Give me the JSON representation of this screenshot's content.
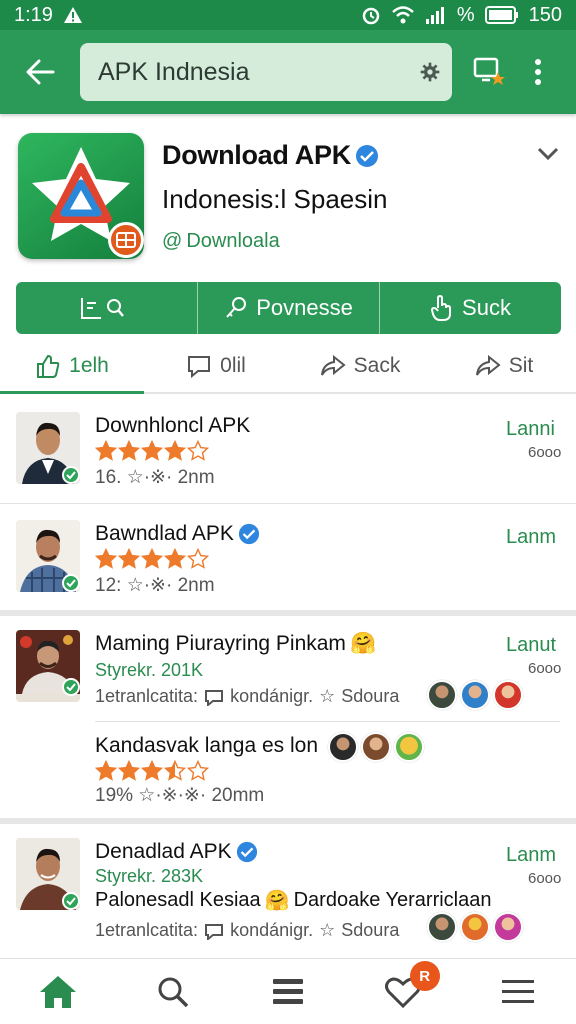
{
  "status": {
    "time": "1:19",
    "battery": "150"
  },
  "search": {
    "value": "APK Indnesia"
  },
  "app": {
    "title": "Download APK",
    "subtitle": "Indonesis:l Spaesin",
    "developer": "Downloala"
  },
  "actions": [
    {
      "label": "",
      "icon": "chart-search-icon"
    },
    {
      "label": "Povnesse",
      "icon": "key-icon"
    },
    {
      "label": "Suck",
      "icon": "hand-pointer-icon"
    }
  ],
  "tabs": [
    {
      "label": "1elh",
      "icon": "thumb-icon",
      "active": true
    },
    {
      "label": "0lil",
      "icon": "comment-icon"
    },
    {
      "label": "Sack",
      "icon": "share-icon"
    },
    {
      "label": "Sit",
      "icon": "forward-icon"
    }
  ],
  "items": [
    {
      "name": "Downhloncl APK",
      "rating": 4,
      "meta": "16. ☆·※· 2nm",
      "right_label": "Lanni",
      "right_count": "6ooo"
    },
    {
      "name": "Bawndlad APK",
      "rating": 4,
      "verified": true,
      "meta": "12: ☆·※· 2nm",
      "right_label": "Lanm"
    },
    {
      "name": "Maming Piurayring Pinkam",
      "emoji": "🤗",
      "subline": "Styrekr. 201K",
      "meta": "1etranlcatita:",
      "meta_word": "kondánigr.",
      "meta_tail": "Sdoura",
      "right_label": "Lanut",
      "right_count": "6ooo"
    },
    {
      "name": "Kandasvak langa es lon",
      "rating": 3.5,
      "meta": "19% ☆·※·※· 20mm"
    },
    {
      "name": "Denadlad APK",
      "verified": true,
      "subline": "Styrekr. 283K",
      "line2": "Palonesadl Kesiaa",
      "line2b": "Dardoake Yerarriclaan",
      "meta": "1etranlcatita:",
      "meta_word": "kondánigr.",
      "meta_tail": "Sdoura",
      "right_label": "Lanm",
      "right_count": "6ooo"
    }
  ],
  "bottom_nav": {
    "badge": "R"
  },
  "colors": {
    "primary": "#2b9a58",
    "star": "#ee7a2b"
  }
}
